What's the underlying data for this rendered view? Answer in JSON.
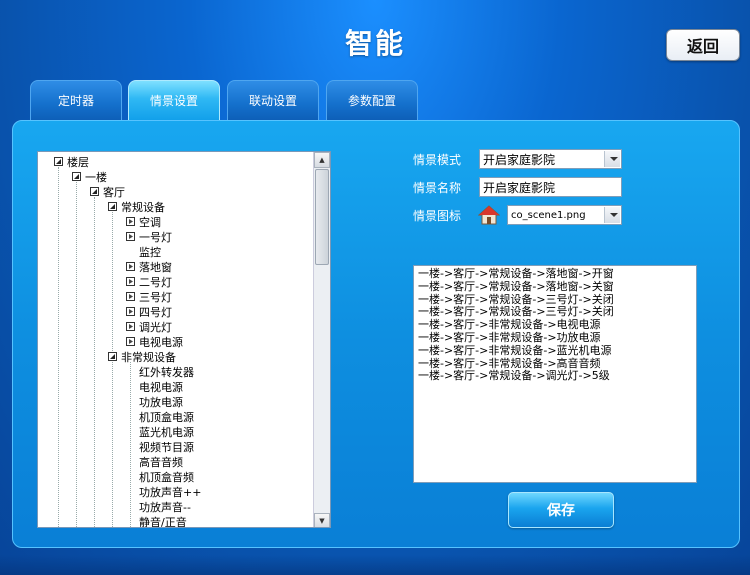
{
  "header": {
    "title": "智能",
    "back_label": "返回"
  },
  "tabs": [
    {
      "label": "定时器",
      "active": false
    },
    {
      "label": "情景设置",
      "active": true
    },
    {
      "label": "联动设置",
      "active": false
    },
    {
      "label": "参数配置",
      "active": false
    }
  ],
  "tree": {
    "nodes": [
      {
        "label": "楼层",
        "toggle": "open"
      },
      {
        "label": "一楼",
        "toggle": "open"
      },
      {
        "label": "客厅",
        "toggle": "open"
      },
      {
        "label": "常规设备",
        "toggle": "open"
      },
      {
        "label": "空调",
        "toggle": "closed"
      },
      {
        "label": "一号灯",
        "toggle": "closed"
      },
      {
        "label": "监控",
        "toggle": "none"
      },
      {
        "label": "落地窗",
        "toggle": "closed"
      },
      {
        "label": "二号灯",
        "toggle": "closed"
      },
      {
        "label": "三号灯",
        "toggle": "closed"
      },
      {
        "label": "四号灯",
        "toggle": "closed"
      },
      {
        "label": "调光灯",
        "toggle": "closed"
      },
      {
        "label": "电视电源",
        "toggle": "closed"
      },
      {
        "label": "非常规设备",
        "toggle": "open"
      },
      {
        "label": "红外转发器",
        "toggle": "none"
      },
      {
        "label": "电视电源",
        "toggle": "none"
      },
      {
        "label": "功放电源",
        "toggle": "none"
      },
      {
        "label": "机顶盒电源",
        "toggle": "none"
      },
      {
        "label": "蓝光机电源",
        "toggle": "none"
      },
      {
        "label": "视频节目源",
        "toggle": "none"
      },
      {
        "label": "高音音频",
        "toggle": "none"
      },
      {
        "label": "机顶盒音频",
        "toggle": "none"
      },
      {
        "label": "功放声音++",
        "toggle": "none"
      },
      {
        "label": "功放声音--",
        "toggle": "none"
      },
      {
        "label": "静音/正音",
        "toggle": "none"
      }
    ]
  },
  "form": {
    "mode_label": "情景模式",
    "mode_value": "开启家庭影院",
    "name_label": "情景名称",
    "name_value": "开启家庭影院",
    "icon_label": "情景图标",
    "icon_value": "co_scene1.png"
  },
  "log": {
    "lines": [
      "一楼->客厅->常规设备->落地窗->开窗",
      "一楼->客厅->常规设备->落地窗->关窗",
      "一楼->客厅->常规设备->三号灯->关闭",
      "一楼->客厅->常规设备->三号灯->关闭",
      "一楼->客厅->非常规设备->电视电源",
      "一楼->客厅->非常规设备->功放电源",
      "一楼->客厅->非常规设备->蓝光机电源",
      "一楼->客厅->非常规设备->高音音频",
      "一楼->客厅->常规设备->调光灯->5级"
    ]
  },
  "save_label": "保存"
}
